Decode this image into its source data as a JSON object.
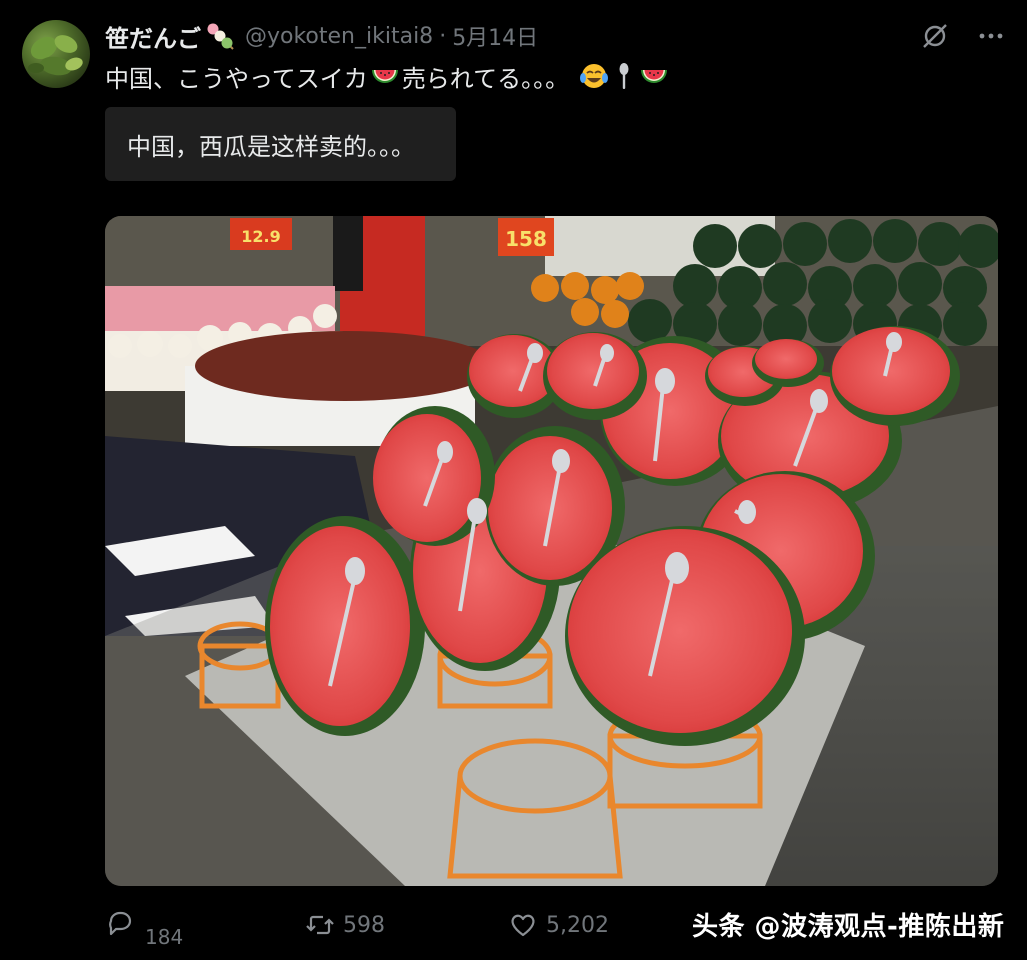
{
  "tweet": {
    "display_name": "笹だんご",
    "handle": "@yokoten_ikitai8",
    "separator": "·",
    "date": "5月14日",
    "text": "中国、こうやってスイカ",
    "text_after_emoji": "売られてる。。。",
    "translation": "中国，西瓜是这样卖的。。。"
  },
  "icons": {
    "avatar": "avatar-image",
    "name_emoji": "dango-emoji",
    "grok": "grok-icon",
    "more": "more-icon",
    "watermelon": "watermelon-emoji",
    "laugh": "tears-of-joy-emoji",
    "spoon": "spoon-emoji"
  },
  "photo": {
    "subject": "watermelon-stall-photo"
  },
  "actions": {
    "reply_count": "184",
    "retweet_count": "598",
    "like_count": "5,202"
  },
  "watermark": "头条 @波涛观点-推陈出新",
  "colors": {
    "background": "#000000",
    "text": "#e7e9ea",
    "muted": "#71767b",
    "translation_bg": "#1f1f1f"
  }
}
